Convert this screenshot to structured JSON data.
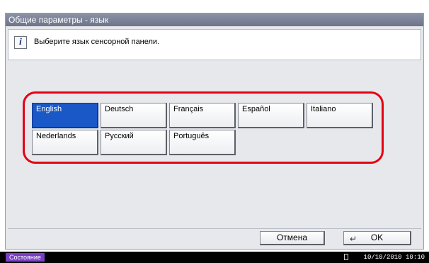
{
  "title": "Общие параметры - язык",
  "message": "Выберите язык сенсорной панели.",
  "languages": [
    {
      "label": "English",
      "selected": true
    },
    {
      "label": "Deutsch",
      "selected": false
    },
    {
      "label": "Français",
      "selected": false
    },
    {
      "label": "Español",
      "selected": false
    },
    {
      "label": "Italiano",
      "selected": false
    },
    {
      "label": "Nederlands",
      "selected": false
    },
    {
      "label": "Русский",
      "selected": false
    },
    {
      "label": "Português",
      "selected": false
    }
  ],
  "footer": {
    "cancel_label": "Отмена",
    "ok_label": "OK"
  },
  "status": {
    "label": "Состояние",
    "datetime": "10/10/2010  10:10"
  },
  "colors": {
    "selected": "#1a58c8",
    "highlight": "#e60012",
    "status_badge": "#7a3fc4"
  }
}
